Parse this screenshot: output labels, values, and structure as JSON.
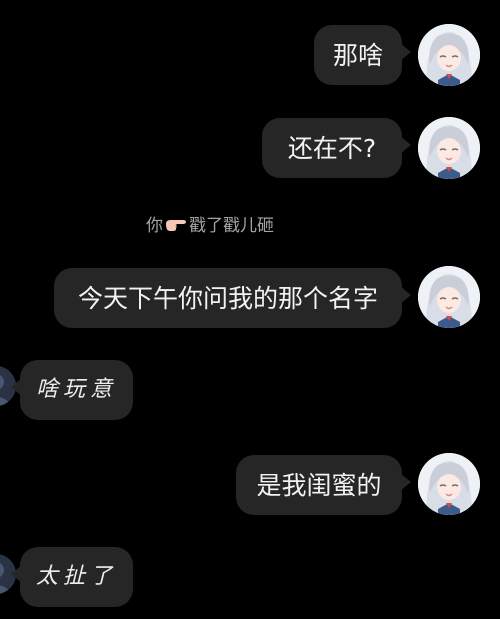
{
  "messages": [
    {
      "side": "right",
      "text": "那啥"
    },
    {
      "side": "right",
      "text": "还在不?"
    },
    {
      "side": "right",
      "text": "今天下午你问我的那个名字"
    },
    {
      "side": "left",
      "text": "啥玩意"
    },
    {
      "side": "right",
      "text": "是我闺蜜的"
    },
    {
      "side": "left",
      "text": "太扯了"
    }
  ],
  "system": {
    "actor": "你",
    "action": "戳了戳儿砸",
    "icon": "pointing-finger-icon"
  },
  "colors": {
    "background": "#000000",
    "bubble": "#262626",
    "bubble_text": "#f2f2f2",
    "system_text": "#a3a3a3"
  }
}
